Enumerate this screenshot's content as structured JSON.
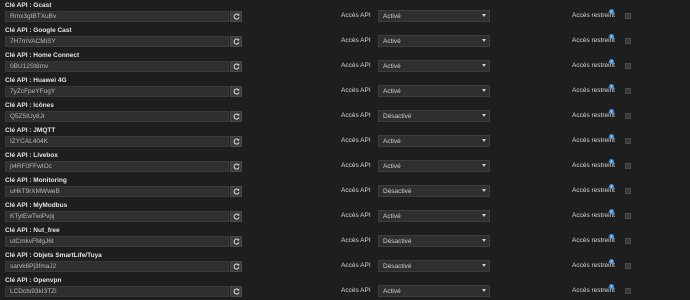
{
  "labels": {
    "api_access": "Accès API",
    "restricted": "Accès restreint",
    "help_glyph": "?"
  },
  "icons": {
    "regenerate": "refresh-icon",
    "help": "question-circle-icon",
    "dropdown": "chevron-down-icon"
  },
  "colors": {
    "background": "#1e1e1e",
    "field": "#2f2f2f",
    "help_badge": "#3e8ed8"
  },
  "plugins": [
    {
      "label": "Clé API : Gcast",
      "key": "Rmx3gtBTXuBv",
      "access": "Activé"
    },
    {
      "label": "Clé API : Google Cast",
      "key": "7H7mVACMiSY",
      "access": "Activé"
    },
    {
      "label": "Clé API : Home Connect",
      "key": "0BU12St8mv",
      "access": "Activé"
    },
    {
      "label": "Clé API : Huawei 4G",
      "key": "7yZcFpeYFugY",
      "access": "Activé"
    },
    {
      "label": "Clé API : Icônes",
      "key": "Q5Z5tUy8Jr",
      "access": "Désactivé"
    },
    {
      "label": "Clé API : JMQTT",
      "key": "IZYCAL404K",
      "access": "Activé"
    },
    {
      "label": "Clé API : Livebox",
      "key": "jt4RF0FFwIOc",
      "access": "Activé"
    },
    {
      "label": "Clé API : Monitoring",
      "key": "uHkT9rXMWweB",
      "access": "Désactivé"
    },
    {
      "label": "Clé API : MyModbus",
      "key": "KTytEwTwiPvpj",
      "access": "Activé"
    },
    {
      "label": "Clé API : Nut_free",
      "key": "utCmkvFMgJ6t",
      "access": "Désactivé"
    },
    {
      "label": "Clé API : Objets SmartLife/Tuya",
      "key": "sarvk6Pj3fmaJ2",
      "access": "Désactivé"
    },
    {
      "label": "Clé API : Openvpn",
      "key": "LCDcIs93kI3TZi",
      "access": "Activé"
    }
  ]
}
